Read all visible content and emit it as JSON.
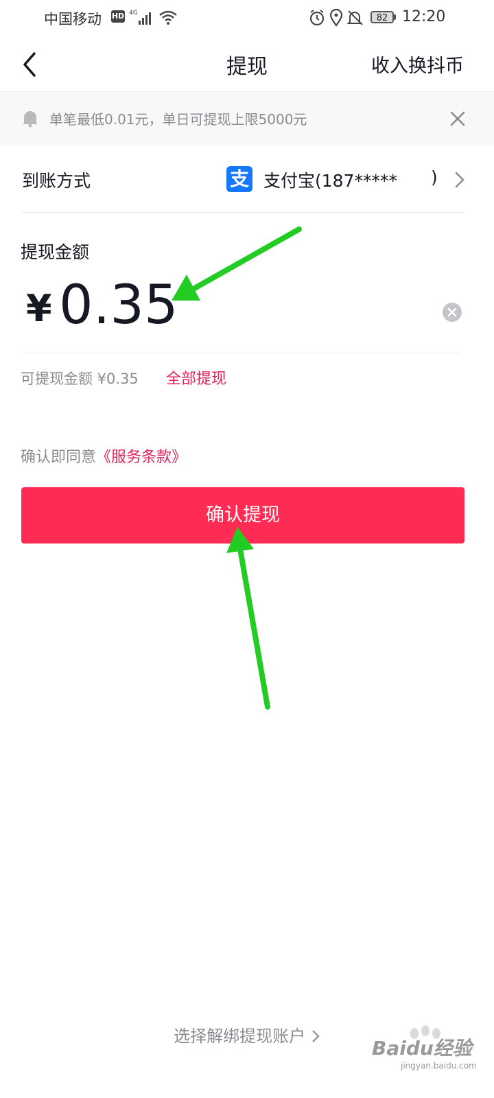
{
  "status_bar": {
    "carrier": "中国移动",
    "hd": "HD",
    "network": "4G",
    "battery": "82",
    "time": "12:20"
  },
  "nav": {
    "title": "提现",
    "right_action": "收入换抖币"
  },
  "notice": {
    "text": "单笔最低0.01元，单日可提现上限5000元"
  },
  "payment": {
    "label": "到账方式",
    "method_icon": "支",
    "account": "支付宝(187*****",
    "account_close": ")"
  },
  "amount": {
    "label": "提现金额",
    "currency": "¥",
    "value": "0.35",
    "available_text": "可提现金额 ¥0.35",
    "withdraw_all": "全部提现"
  },
  "agreement": {
    "prefix": "确认即同意",
    "link": "《服务条款》"
  },
  "confirm_button": "确认提现",
  "unbind_link": "选择解绑提现账户",
  "watermark": {
    "text": "Baidu经验",
    "sub": "jingyan.baidu.com"
  },
  "colors": {
    "accent": "#fe2c55",
    "link": "#e0245e",
    "alipay": "#1677ff",
    "annotation_arrow": "#22cc22"
  }
}
